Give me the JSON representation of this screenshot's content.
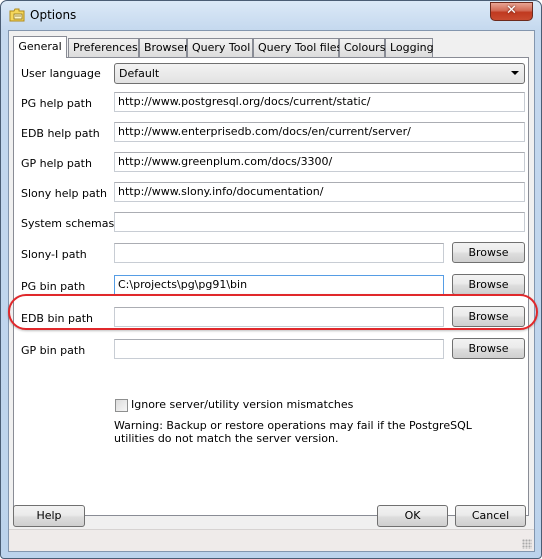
{
  "window": {
    "title": "Options",
    "icon": "folder-options-icon",
    "close_glyph": "✕"
  },
  "tabs": [
    {
      "label": "General",
      "active": true
    },
    {
      "label": "Preferences",
      "active": false
    },
    {
      "label": "Browser",
      "active": false
    },
    {
      "label": "Query Tool",
      "active": false
    },
    {
      "label": "Query Tool files",
      "active": false
    },
    {
      "label": "Colours",
      "active": false
    },
    {
      "label": "Logging",
      "active": false
    }
  ],
  "general": {
    "user_language": {
      "label": "User language",
      "value": "Default"
    },
    "pg_help_path": {
      "label": "PG help path",
      "value": "http://www.postgresql.org/docs/current/static/"
    },
    "edb_help_path": {
      "label": "EDB help path",
      "value": "http://www.enterprisedb.com/docs/en/current/server/"
    },
    "gp_help_path": {
      "label": "GP help path",
      "value": "http://www.greenplum.com/docs/3300/"
    },
    "slony_help_path": {
      "label": "Slony help path",
      "value": "http://www.slony.info/documentation/"
    },
    "system_schemas": {
      "label": "System schemas",
      "value": ""
    },
    "slony_i_path": {
      "label": "Slony-I path",
      "value": "",
      "browse": "Browse"
    },
    "pg_bin_path": {
      "label": "PG bin path",
      "value": "C:\\projects\\pg\\pg91\\bin",
      "browse": "Browse"
    },
    "edb_bin_path": {
      "label": "EDB bin path",
      "value": "",
      "browse": "Browse"
    },
    "gp_bin_path": {
      "label": "GP bin path",
      "value": "",
      "browse": "Browse"
    },
    "ignore_mismatch": {
      "label": "Ignore server/utility version mismatches",
      "checked": false
    },
    "warning": "Warning: Backup or restore operations may fail if the PostgreSQL utilities do not match the server version."
  },
  "footer": {
    "help": "Help",
    "ok": "OK",
    "cancel": "Cancel"
  },
  "colors": {
    "highlight_ring": "#e0282b",
    "focus_border": "#569de5"
  }
}
